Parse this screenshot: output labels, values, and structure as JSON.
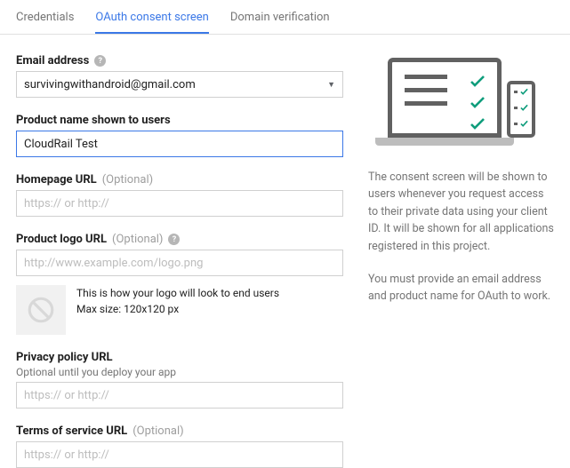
{
  "tabs": {
    "credentials": "Credentials",
    "consent": "OAuth consent screen",
    "domain": "Domain verification"
  },
  "fields": {
    "email": {
      "label": "Email address",
      "value": "survivingwithandroid@gmail.com"
    },
    "product_name": {
      "label": "Product name shown to users",
      "value": "CloudRail Test"
    },
    "homepage": {
      "label": "Homepage URL",
      "optional": "(Optional)",
      "placeholder": "https:// or http://"
    },
    "logo_url": {
      "label": "Product logo URL",
      "optional": "(Optional)",
      "placeholder": "http://www.example.com/logo.png",
      "hint1": "This is how your logo will look to end users",
      "hint2": "Max size: 120x120 px"
    },
    "privacy": {
      "label": "Privacy policy URL",
      "sublabel": "Optional until you deploy your app",
      "placeholder": "https:// or http://"
    },
    "tos": {
      "label": "Terms of service URL",
      "optional": "(Optional)",
      "placeholder": "https:// or http://"
    }
  },
  "sidebar": {
    "p1": "The consent screen will be shown to users whenever you request access to their private data using your client ID. It will be shown for all applications registered in this project.",
    "p2": "You must provide an email address and product name for OAuth to work."
  }
}
